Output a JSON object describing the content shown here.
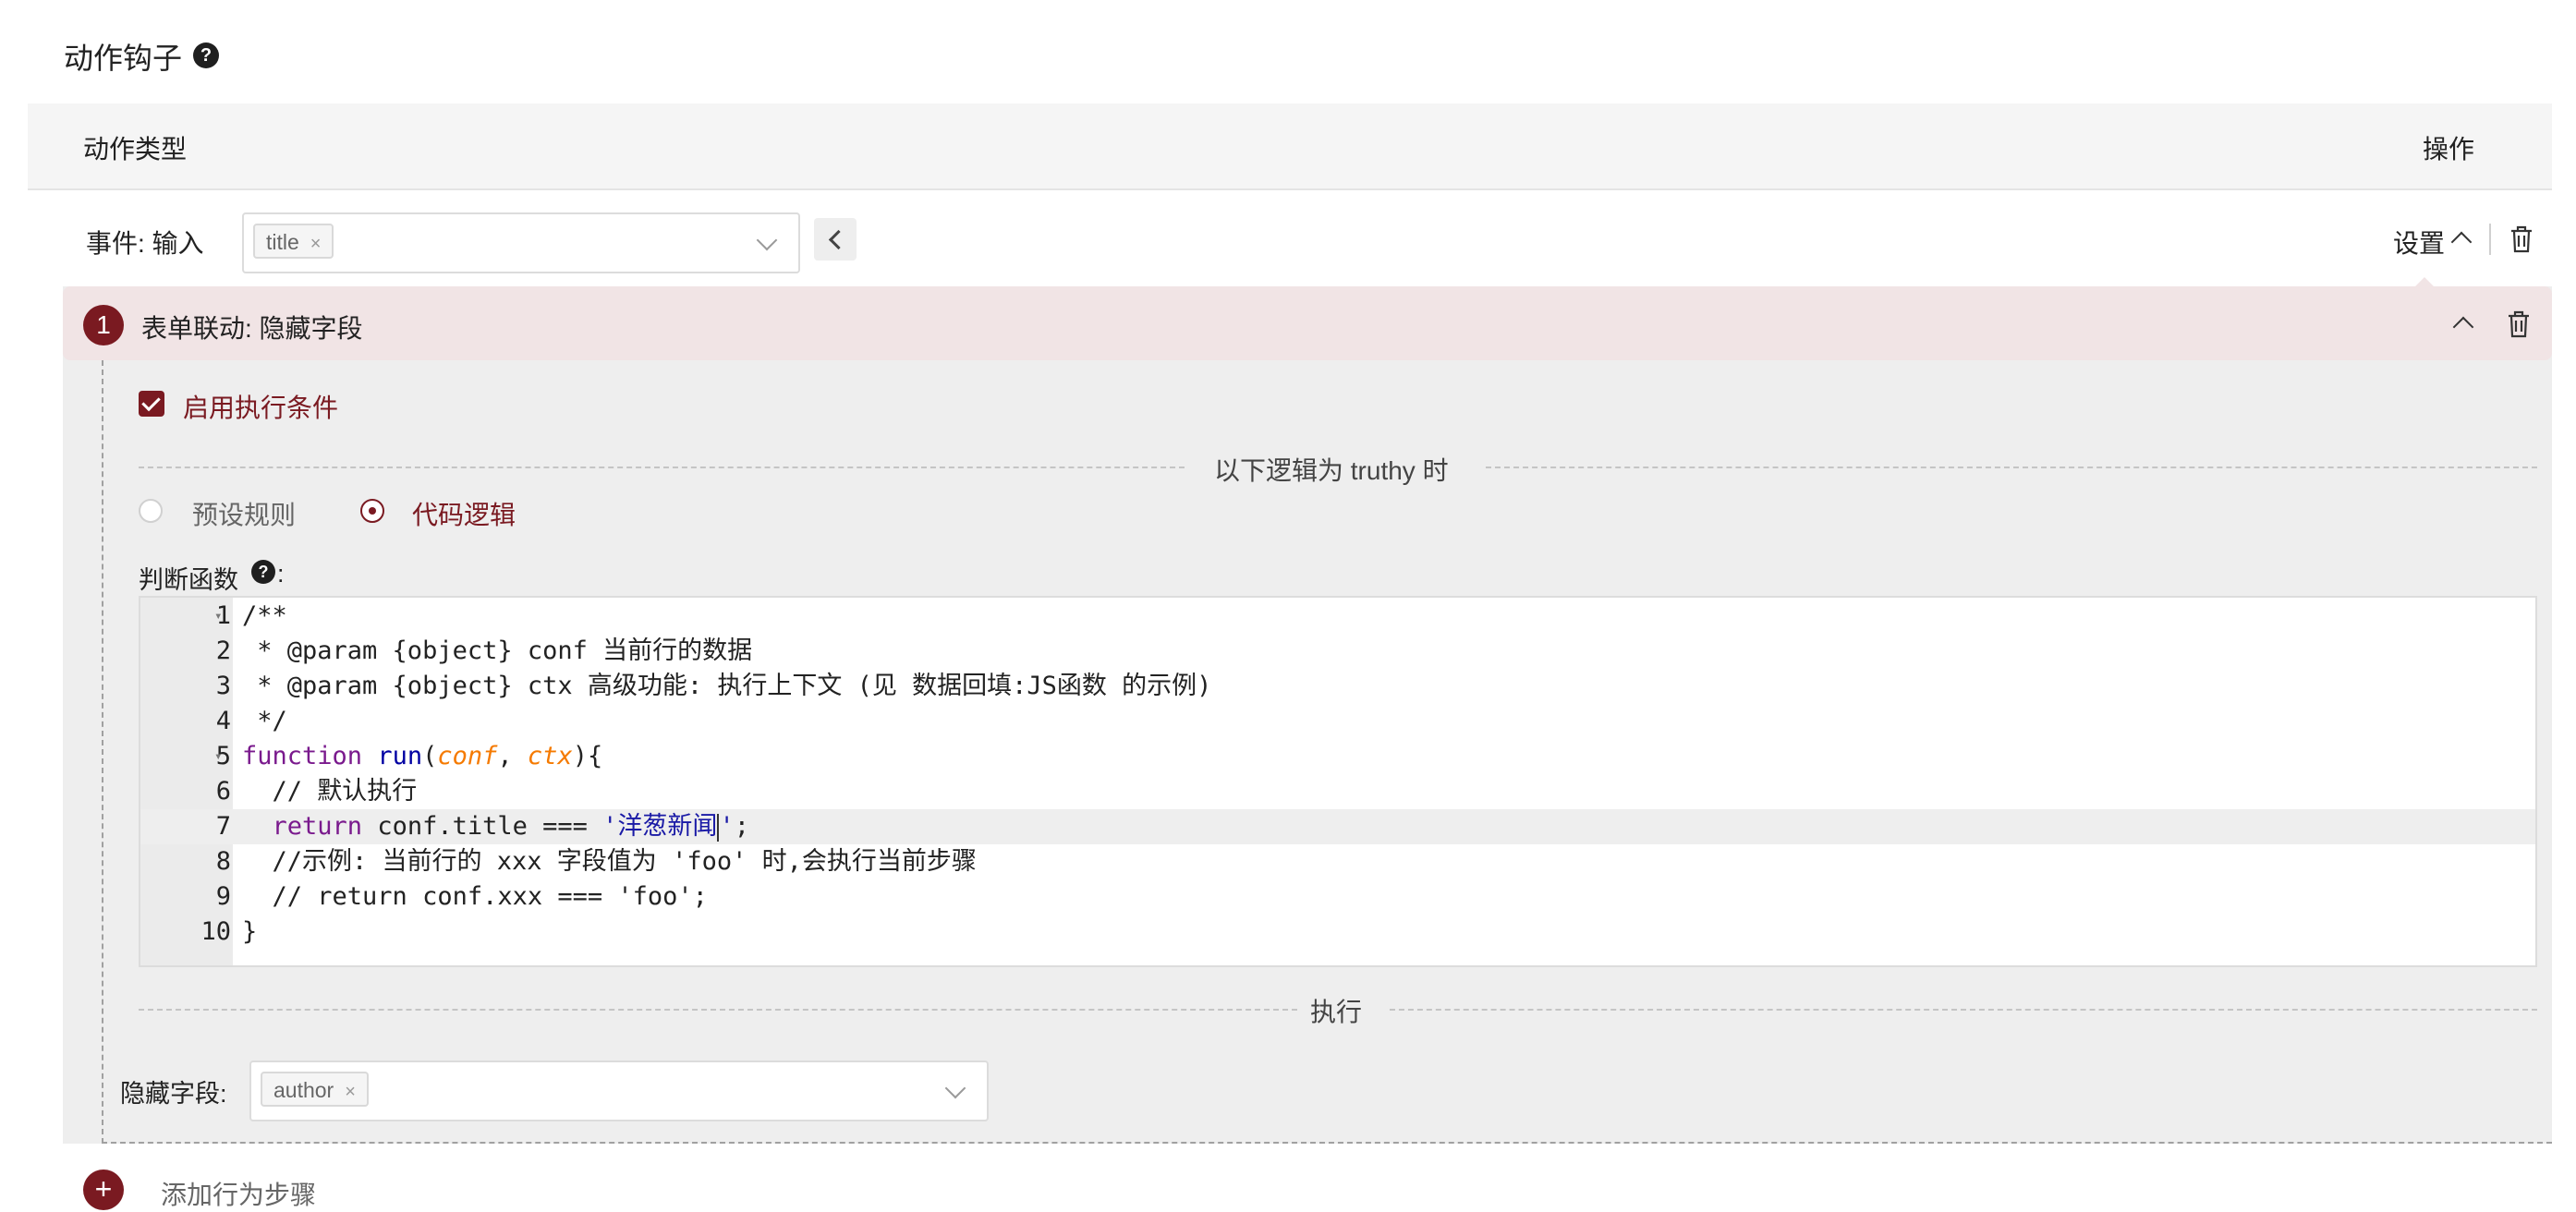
{
  "page": {
    "title": "动作钩子",
    "help_icon": "question-circle-icon"
  },
  "table": {
    "col_action_type": "动作类型",
    "col_operation": "操作"
  },
  "event_row": {
    "label": "事件: 输入",
    "selected_tags": [
      "title"
    ],
    "settings_label": "设置",
    "delete_icon": "trash-icon"
  },
  "action": {
    "step_number": "1",
    "title": "表单联动: 隐藏字段",
    "enable_condition_label": "启用执行条件",
    "enable_condition_checked": true,
    "truthy_divider": "以下逻辑为 truthy 时",
    "radio_preset": "预设规则",
    "radio_code": "代码逻辑",
    "selected_mode": "代码逻辑",
    "judge_fn_label": "判断函数",
    "judge_fn_colon": ":",
    "code_lines": [
      "/**",
      " * @param {object} conf 当前行的数据",
      " * @param {object} ctx 高级功能: 执行上下文 (见 数据回填:JS函数 的示例)",
      " */",
      "function run(conf, ctx){",
      "  // 默认执行",
      "  return conf.title === '洋葱新闻';",
      "  //示例: 当前行的 xxx 字段值为 'foo' 时,会执行当前步骤",
      "  // return conf.xxx === 'foo';",
      "}"
    ],
    "code_parts": {
      "fn_keyword": "function",
      "fn_name": "run",
      "param1": "conf",
      "param2": "ctx",
      "return_kw": "return",
      "return_expr": "conf.title === ",
      "return_str_a": "'洋葱新闻",
      "return_str_b": "'",
      "return_end": ";"
    },
    "active_line": 7,
    "execute_divider": "执行",
    "hide_field_label": "隐藏字段:",
    "hide_field_tags": [
      "author"
    ]
  },
  "footer": {
    "add_step_label": "添加行为步骤"
  },
  "colors": {
    "accent": "#7a1a21",
    "action_header_bg": "#f1e4e5",
    "panel_bg": "#eeeeee"
  }
}
